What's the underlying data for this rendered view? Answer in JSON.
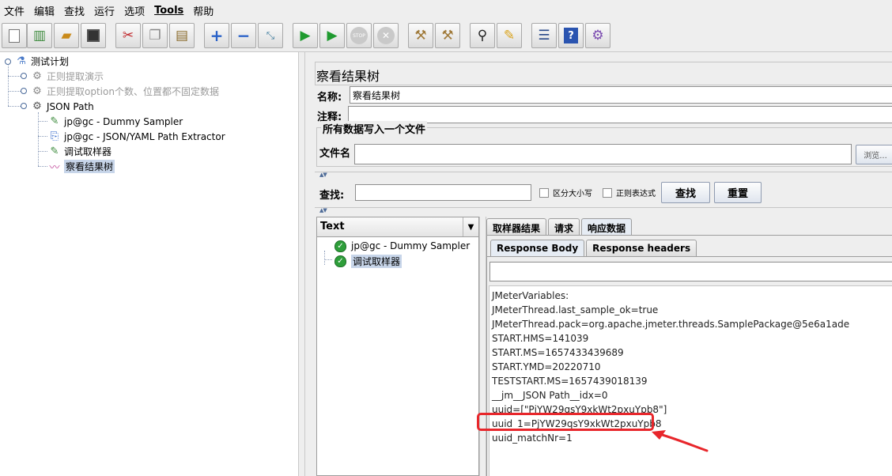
{
  "menu": [
    "文件",
    "编辑",
    "查找",
    "运行",
    "选项",
    "Tools",
    "帮助"
  ],
  "toolbar": {
    "buttons": [
      "new-icon",
      "templates-icon",
      "open-icon",
      "save-icon",
      "cut-icon",
      "copy-icon",
      "paste-icon",
      "expand-icon",
      "collapse-icon",
      "toggle-icon",
      "start-icon",
      "start-no-timers-icon",
      "stop-icon",
      "shutdown-icon",
      "clear-icon",
      "clear-all-icon",
      "search-icon",
      "reset-search-icon",
      "function-helper-icon",
      "help-icon",
      "remote-icon"
    ]
  },
  "tree": {
    "root": "测试计划",
    "items": [
      {
        "label": "正则提取演示",
        "disabled": true
      },
      {
        "label": "正则提取option个数、位置都不固定数据",
        "disabled": true
      },
      {
        "label": "JSON Path",
        "disabled": false
      },
      {
        "label": "jp@gc - Dummy Sampler"
      },
      {
        "label": "jp@gc - JSON/YAML Path Extractor"
      },
      {
        "label": "调试取样器"
      },
      {
        "label": "察看结果树"
      }
    ]
  },
  "panel": {
    "title": "察看结果树",
    "name_label": "名称:",
    "name_value": "察看结果树",
    "comment_label": "注释:",
    "comment_value": "",
    "file_group_title": "所有数据写入一个文件",
    "filename_label": "文件名",
    "filename_value": "",
    "browse_label": "浏览..."
  },
  "search": {
    "label": "查找:",
    "value": "",
    "case_label": "区分大小写",
    "regex_label": "正则表达式",
    "find_button": "查找",
    "reset_button": "重置"
  },
  "results": {
    "renderer": "Text",
    "samples": [
      "jp@gc - Dummy Sampler",
      "调试取样器"
    ],
    "tabs": [
      "取样器结果",
      "请求",
      "响应数据"
    ],
    "inner_tabs": [
      "Response Body",
      "Response headers"
    ],
    "body_lines": [
      "JMeterVariables:",
      "JMeterThread.last_sample_ok=true",
      "JMeterThread.pack=org.apache.jmeter.threads.SamplePackage@5e6a1ade",
      "START.HMS=141039",
      "START.MS=1657433439689",
      "START.YMD=20220710",
      "TESTSTART.MS=1657439018139",
      "__jm__JSON Path__idx=0",
      "uuid=[\"PjYW29qsY9xkWt2pxuYpb8\"]",
      "uuid_1=PjYW29qsY9xkWt2pxuYpb8",
      "uuid_matchNr=1"
    ]
  },
  "colors": {
    "highlight": "#e8262b",
    "selection": "#c7d5e9"
  }
}
